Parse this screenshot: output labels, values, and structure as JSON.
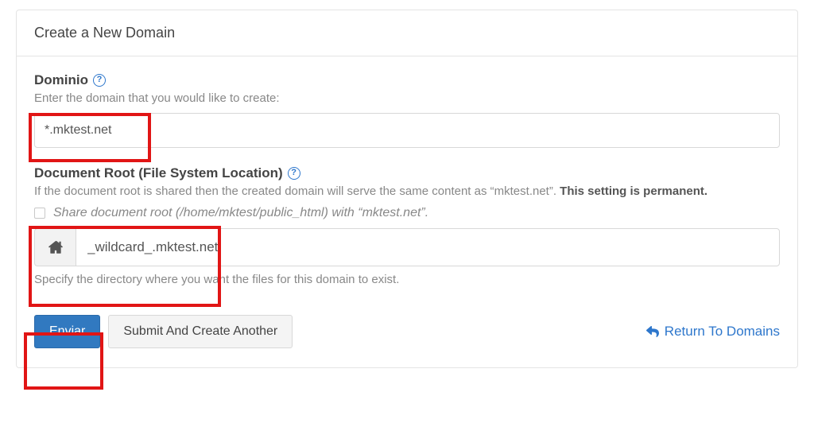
{
  "panel": {
    "title": "Create a New Domain"
  },
  "domain": {
    "label": "Dominio",
    "hint": "Enter the domain that you would like to create:",
    "value": "*.mktest.net"
  },
  "docroot": {
    "label": "Document Root (File System Location)",
    "hint_prefix": "If the document root is shared then the created domain will serve the same content as “mktest.net”. ",
    "hint_bold": "This setting is permanent.",
    "share_label": "Share document root (/home/mktest/public_html) with “mktest.net”.",
    "value": "_wildcard_.mktest.net",
    "subtext": "Specify the directory where you want the files for this domain to exist."
  },
  "actions": {
    "submit": "Enviar",
    "submit_another": "Submit And Create Another",
    "return": "Return To Domains"
  }
}
